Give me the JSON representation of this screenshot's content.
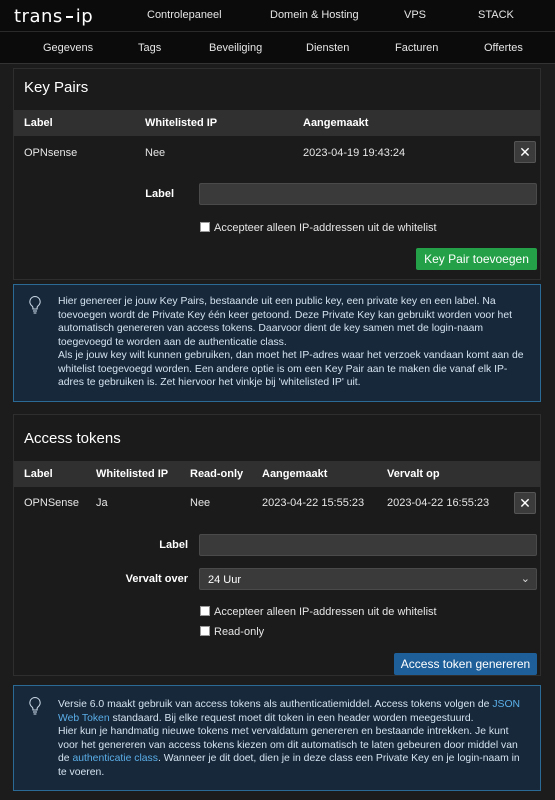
{
  "brand": {
    "logo_left": "trans",
    "logo_right": "ip"
  },
  "topnav": [
    "Controlepaneel",
    "Domein & Hosting",
    "VPS",
    "STACK"
  ],
  "subnav": [
    "Gegevens",
    "Tags",
    "Beveiliging",
    "Diensten",
    "Facturen",
    "Offertes"
  ],
  "key_pairs": {
    "title": "Key Pairs",
    "columns": [
      "Label",
      "Whitelisted IP",
      "Aangemaakt"
    ],
    "rows": [
      {
        "label": "OPNsense",
        "whitelisted": "Nee",
        "created": "2023-04-19 19:43:24"
      }
    ],
    "form": {
      "label_text": "Label",
      "label_value": "",
      "whitelist_checkbox": "Accepteer alleen IP-addressen uit de whitelist",
      "whitelist_checked": false,
      "submit": "Key Pair toevoegen"
    },
    "info_text": [
      "Hier genereer je jouw Key Pairs, bestaande uit een public key, een private key en een label. Na toevoegen wordt de Private Key één keer getoond. Deze Private Key kan gebruikt worden voor het automatisch genereren van access tokens. Daarvoor dient de key samen met de login-naam toegevoegd te worden aan de authenticatie class.",
      "Als je jouw key wilt kunnen gebruiken, dan moet het IP-adres waar het verzoek vandaan komt aan de whitelist toegevoegd worden. Een andere optie is om een Key Pair aan te maken die vanaf elk IP-adres te gebruiken is. Zet hiervoor het vinkje bij 'whitelisted IP' uit."
    ]
  },
  "access_tokens": {
    "title": "Access tokens",
    "columns": [
      "Label",
      "Whitelisted IP",
      "Read-only",
      "Aangemaakt",
      "Vervalt op"
    ],
    "rows": [
      {
        "label": "OPNSense",
        "whitelisted": "Ja",
        "readonly": "Nee",
        "created": "2023-04-22 15:55:23",
        "expires": "2023-04-22 16:55:23"
      }
    ],
    "form": {
      "label_text": "Label",
      "label_value": "",
      "expires_text": "Vervalt over",
      "expires_value": "24 Uur",
      "whitelist_checkbox": "Accepteer alleen IP-addressen uit de whitelist",
      "whitelist_checked": false,
      "readonly_checkbox": "Read-only",
      "readonly_checked": false,
      "submit": "Access token genereren"
    },
    "info": {
      "p1_a": "Versie 6.0 maakt gebruik van access tokens als authenticatiemiddel. Access tokens volgen de ",
      "p1_link": "JSON Web Token",
      "p1_b": " standaard. Bij elke request moet dit token in een header worden meegestuurd.",
      "p2_a": "Hier kun je handmatig nieuwe tokens met vervaldatum genereren en bestaande intrekken. Je kunt voor het genereren van access tokens kiezen om dit automatisch te laten gebeuren door middel van de ",
      "p2_link": "authenticatie class",
      "p2_b": ". Wanneer je dit doet, dien je in deze class een Private Key en je login-naam in te voeren."
    }
  },
  "colors": {
    "accent_green": "#24a148",
    "accent_blue": "#1f5f99",
    "link": "#5aaee8"
  }
}
